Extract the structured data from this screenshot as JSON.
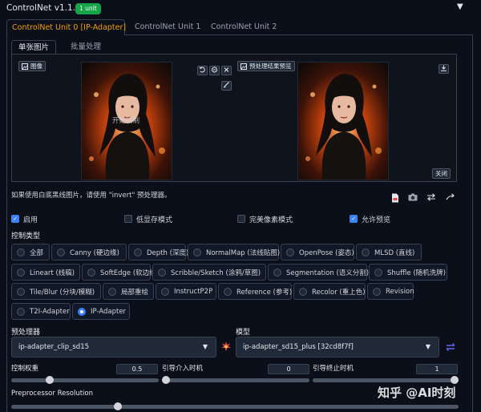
{
  "header": {
    "title": "ControlNet v1.1.410",
    "badge": "1 unit",
    "caret": "▼"
  },
  "unit_tabs": [
    "ControlNet Unit 0 [IP-Adapter]",
    "ControlNet Unit 1",
    "ControlNet Unit 2"
  ],
  "image_tabs": [
    "单张图片",
    "批量处理"
  ],
  "image_panel": {
    "image_label": "图像",
    "start_hint": "开始绘制",
    "preview_button": "预处理结果预览",
    "close_button": "关闭",
    "undo_icon": "undo-icon",
    "clear_icon": "clear-icon",
    "close_icon": "close-icon",
    "brush_icon": "brush-icon",
    "download_icon": "download-icon"
  },
  "tip": "如果使用白底黑线图片，请使用 \"invert\" 预处理器。",
  "checkboxes": [
    {
      "label": "启用",
      "checked": true
    },
    {
      "label": "低显存模式",
      "checked": false
    },
    {
      "label": "完美像素模式",
      "checked": false
    },
    {
      "label": "允许预览",
      "checked": true
    }
  ],
  "control_type": {
    "label": "控制类型",
    "options": [
      "全部",
      "Canny (硬边缘)",
      "Depth (深度)",
      "NormalMap (法线贴图)",
      "OpenPose (姿态)",
      "MLSD (直线)",
      "Lineart (线稿)",
      "SoftEdge (软边缘)",
      "Scribble/Sketch (涂鸦/草图)",
      "Segmentation (语义分割)",
      "Shuffle (随机洗牌)",
      "Tile/Blur (分块/模糊)",
      "局部重绘",
      "InstructP2P",
      "Reference (参考)",
      "Recolor (重上色)",
      "Revision",
      "T2I-Adapter",
      "IP-Adapter"
    ],
    "selected": "IP-Adapter"
  },
  "preprocessor": {
    "label": "预处理器",
    "value": "ip-adapter_clip_sd15"
  },
  "model": {
    "label": "模型",
    "value": "ip-adapter_sd15_plus [32cd8f7f]"
  },
  "sliders": [
    {
      "label": "控制权重",
      "value": "0.5"
    },
    {
      "label": "引导介入时机",
      "value": "0"
    },
    {
      "label": "引导终止时机",
      "value": "1"
    }
  ],
  "preprocessor_resolution": {
    "label": "Preprocessor Resolution"
  },
  "watermark": "知乎 @AI时刻",
  "colors": {
    "accent": "#f59e0b",
    "primary": "#3b82f6",
    "badge": "#16a34a",
    "bg": "#0b0f19"
  }
}
